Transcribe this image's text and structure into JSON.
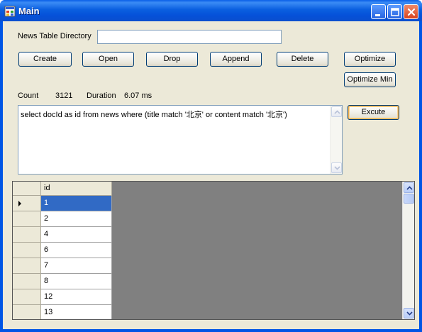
{
  "window": {
    "title": "Main"
  },
  "form": {
    "directory_label": "News Table Directory",
    "directory_value": "",
    "buttons": {
      "create": "Create",
      "open": "Open",
      "drop": "Drop",
      "append": "Append",
      "delete": "Delete",
      "optimize": "Optimize",
      "optimize_min": "Optimize Min",
      "execute": "Excute"
    },
    "stats": {
      "count_label": "Count",
      "count_value": "3121",
      "duration_label": "Duration",
      "duration_value": "6.07 ms"
    },
    "query_text": "select docId as id from news where (title match '北京' or content match '北京')"
  },
  "grid": {
    "column_header": "id",
    "rows": [
      "1",
      "2",
      "4",
      "6",
      "7",
      "8",
      "12",
      "13"
    ],
    "selected_row": "1"
  },
  "colors": {
    "titlebar": "#0055e5",
    "form_background": "#ece9d8",
    "selection": "#316ac5",
    "grid_background": "#808080"
  }
}
